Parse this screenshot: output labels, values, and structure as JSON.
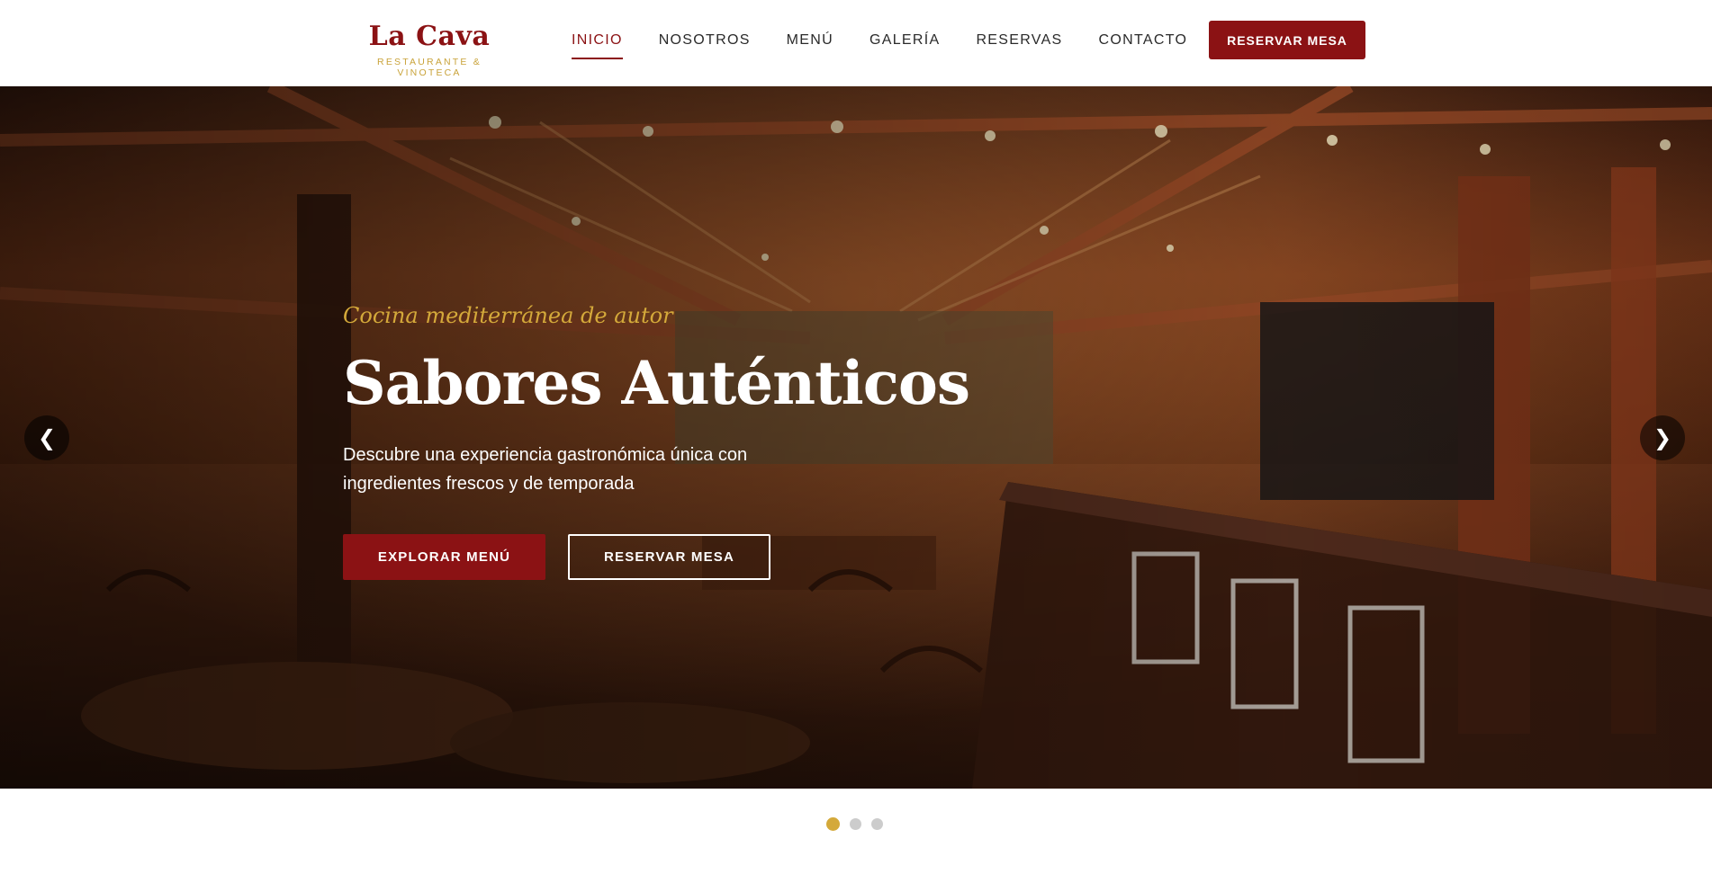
{
  "brand": {
    "name": "La Cava",
    "subtitle": "RESTAURANTE & VINOTECA"
  },
  "nav": {
    "items": [
      {
        "label": "INICIO",
        "active": true
      },
      {
        "label": "NOSOTROS",
        "active": false
      },
      {
        "label": "MENÚ",
        "active": false
      },
      {
        "label": "GALERÍA",
        "active": false
      },
      {
        "label": "RESERVAS",
        "active": false
      },
      {
        "label": "CONTACTO",
        "active": false
      }
    ],
    "cta_label": "RESERVAR MESA"
  },
  "hero": {
    "tagline": "Cocina mediterránea de autor",
    "title": "Sabores Auténticos",
    "description": "Descubre una experiencia gastronómica única con ingredientes frescos y de temporada",
    "primary_button": "EXPLORAR MENÚ",
    "secondary_button": "RESERVAR MESA",
    "prev_icon": "chevron-left-icon",
    "next_icon": "chevron-right-icon",
    "prev_glyph": "❮",
    "next_glyph": "❯"
  },
  "slider": {
    "total_slides": 3,
    "active_slide": 1
  },
  "colors": {
    "brand_red": "#8b1214",
    "gold": "#d4a93a",
    "dot_inactive": "#cccccc"
  }
}
